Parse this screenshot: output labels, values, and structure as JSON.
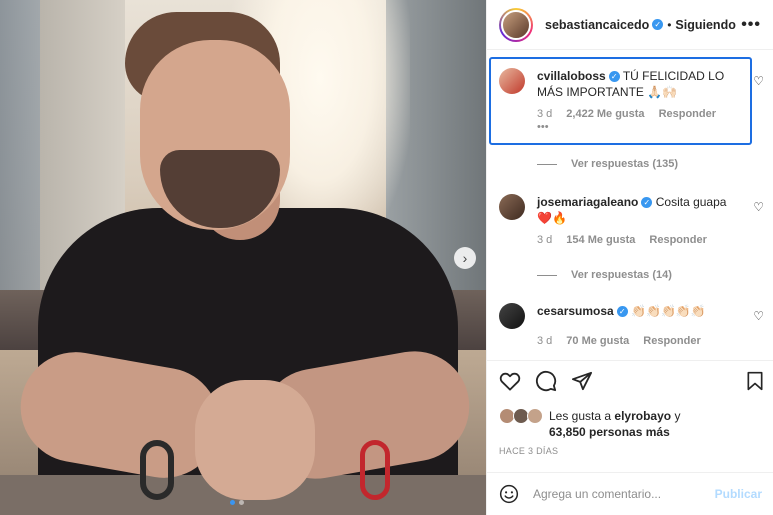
{
  "header": {
    "username": "sebastiancaicedo",
    "follow_label": "Siguiendo",
    "more_label": "•••"
  },
  "comments": [
    {
      "username": "cvillaloboss",
      "text": "TÚ FELICIDAD LO MÁS IMPORTANTE 🙏🏻🙌🏻",
      "time": "3 d",
      "likes": "2,422 Me gusta",
      "reply_label": "Responder",
      "more_label": "•••",
      "replies_label": "Ver respuestas (135)"
    },
    {
      "username": "josemariagaleano",
      "text": "Cosita guapa ❤️🔥",
      "time": "3 d",
      "likes": "154 Me gusta",
      "reply_label": "Responder",
      "replies_label": "Ver respuestas (14)"
    },
    {
      "username": "cesarsumosa",
      "text": "👏🏻👏🏻👏🏻👏🏻👏🏻",
      "time": "3 d",
      "likes": "70 Me gusta",
      "reply_label": "Responder"
    }
  ],
  "likes": {
    "prefix": "Les gusta a",
    "user": "elyrobayo",
    "and": "y",
    "rest": "63,850 personas más"
  },
  "posted_time": "HACE 3 DÍAS",
  "comment_box": {
    "placeholder": "Agrega un comentario...",
    "post_label": "Publicar"
  },
  "carousel": {
    "slides": 2,
    "current": 1
  },
  "colors": {
    "accent": "#3897f0",
    "highlight": "#1d6ee2",
    "post_disabled": "#b3dbff"
  },
  "icons": [
    "heart-icon",
    "comment-icon",
    "share-icon",
    "bookmark-icon",
    "emoji-icon",
    "chevron-right-icon",
    "verified-icon"
  ]
}
